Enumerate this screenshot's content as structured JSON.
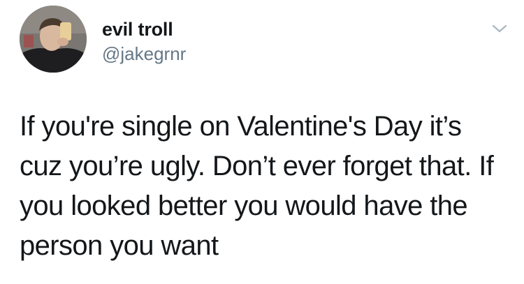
{
  "author": {
    "display_name": "evil troll",
    "handle": "@jakegrnr"
  },
  "icons": {
    "avatar": "profile-photo",
    "menu": "chevron-down-icon"
  },
  "tweet": {
    "lines": [
      "If you're single on Valentine's Day it’s",
      "cuz you’re ugly. Don’t ever forget that. If",
      "you looked better you would have the",
      "person you want"
    ]
  },
  "colors": {
    "text": "#14171a",
    "secondary": "#657786",
    "background": "#ffffff"
  }
}
